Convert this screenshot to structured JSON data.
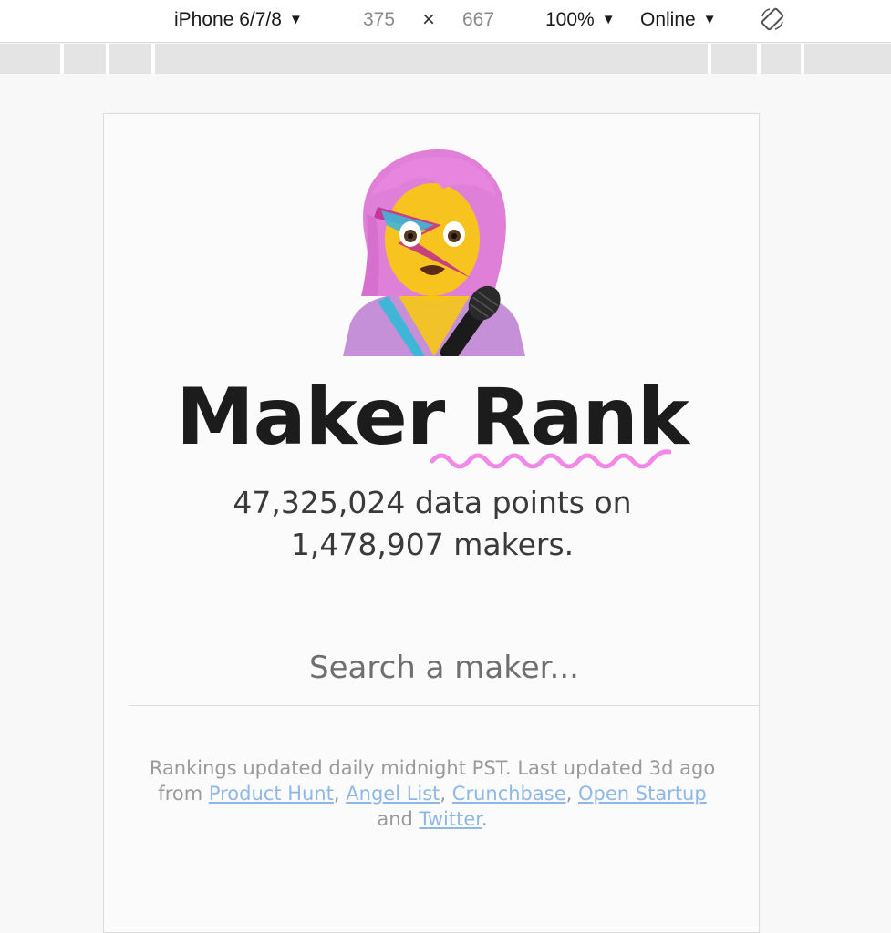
{
  "toolbar": {
    "device": "iPhone 6/7/8",
    "width": "375",
    "times": "×",
    "height": "667",
    "zoom": "100%",
    "network": "Online",
    "dropdown_arrow": "▼"
  },
  "page": {
    "title": "Maker Rank",
    "stats_line1": "47,325,024 data points on",
    "stats_line2": "1,478,907 makers.",
    "search": {
      "placeholder": "Search a maker...",
      "value": ""
    },
    "footer": {
      "text_before": "Rankings updated daily midnight PST. Last updated 3d ago from ",
      "links": [
        "Product Hunt",
        "Angel List",
        "Crunchbase",
        "Open Startup",
        "Twitter"
      ],
      "sep_comma": ", ",
      "sep_and": " and ",
      "end": "."
    },
    "hero_icon": "singer-emoji-icon",
    "accent_squiggle_color": "#f08ae6"
  }
}
